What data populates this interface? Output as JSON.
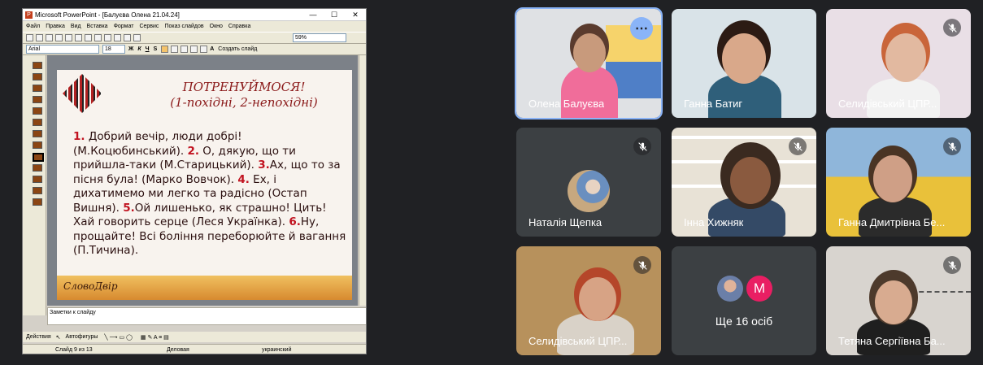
{
  "ppt": {
    "window_title": "Microsoft PowerPoint - [Балуєва Олена 21.04.24]",
    "menu": [
      "Файл",
      "Правка",
      "Вид",
      "Вставка",
      "Формат",
      "Сервис",
      "Показ слайдов",
      "Окно",
      "Справка"
    ],
    "zoom": "59%",
    "font_name": "Arial",
    "font_size": "18",
    "create_slide": "Создать слайд",
    "slide": {
      "title": "ПОТРЕНУЙМОСЯ!",
      "subtitle": "(1-похідні, 2-непохідні)",
      "body_parts": [
        {
          "n": "1.",
          "t": " Добрий вечір, люди добрі! (М.Коцюбинський). "
        },
        {
          "n": "2.",
          "t": " О, дякую, що ти прийшла-таки (М.Старицький). "
        },
        {
          "n": "3.",
          "t": "Ах, що то за пісня була! (Марко Вовчок). "
        },
        {
          "n": "4.",
          "t": " Ех, і дихатимемо ми легко та радісно (Остап Вишня). "
        },
        {
          "n": "5.",
          "t": "Ой лишенько, як страшно! Цить! Хай говорить серце (Леся Українка). "
        },
        {
          "n": "6.",
          "t": "Ну, прощайте! Всі боління переборюйте й вагання (П.Тичина)."
        }
      ],
      "logo": "СловоДвір"
    },
    "notes": "Заметки к слайду",
    "draw_actions": "Действия",
    "autoshapes": "Автофигуры",
    "status": {
      "slide": "Слайд 9 из 13",
      "design": "Деловая",
      "lang": "украинский"
    }
  },
  "participants": [
    {
      "name": "Олена Балуєва",
      "muted": false,
      "active": true
    },
    {
      "name": "Ганна Батиг",
      "muted": false
    },
    {
      "name": "Селидівський ЦПР...",
      "muted": true
    },
    {
      "name": "Наталія Щепка",
      "muted": true
    },
    {
      "name": "Інна Хижняк",
      "muted": true
    },
    {
      "name": "Ганна Дмитрівна Бе...",
      "muted": true
    },
    {
      "name": "Селидівський ЦПР...",
      "muted": true
    },
    {
      "name": "Ще 16 осіб",
      "muted": false,
      "more_initial": "M"
    },
    {
      "name": "Тетяна Сергіївна Ба...",
      "muted": true
    }
  ],
  "colors": {
    "accent": "#8ab4f8",
    "meet_bg": "#202124",
    "tile_bg": "#3c4043",
    "more_badge": "#e91e63"
  }
}
